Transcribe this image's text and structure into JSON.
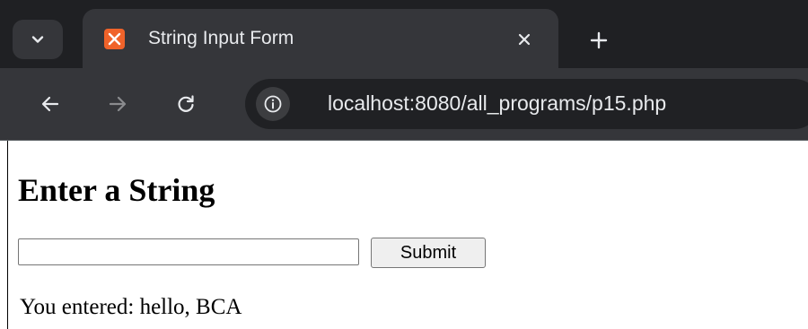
{
  "browser": {
    "tab": {
      "title": "String Input Form",
      "favicon": "xampp-icon"
    },
    "address_bar": {
      "url": "localhost:8080/all_programs/p15.php"
    },
    "icons": {
      "tab_search": "chevron-down-icon",
      "close": "close-icon",
      "new_tab": "plus-icon",
      "back": "back-arrow-icon",
      "forward": "forward-arrow-icon",
      "reload": "reload-icon",
      "site_info": "info-icon"
    },
    "colors": {
      "tabstrip": "#1f2023",
      "toolbar": "#35363a",
      "favicon": "#f0632a"
    }
  },
  "page": {
    "heading": "Enter a String",
    "input": {
      "value": ""
    },
    "submit_label": "Submit",
    "result": {
      "label": "You entered: ",
      "value": "hello, BCA"
    }
  }
}
